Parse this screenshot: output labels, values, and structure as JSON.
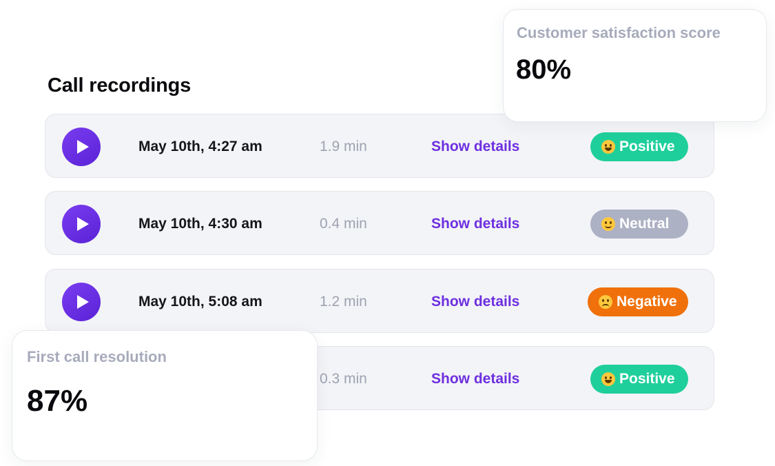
{
  "section": {
    "title": "Call recordings"
  },
  "recordings": [
    {
      "time": "May 10th, 4:27 am",
      "duration": "1.9 min",
      "details_label": "Show details",
      "sentiment": "Positive",
      "sentiment_kind": "positive",
      "sentiment_icon": "grinning-face-icon",
      "play_icon": "play-icon"
    },
    {
      "time": "May 10th, 4:30 am",
      "duration": "0.4 min",
      "details_label": "Show details",
      "sentiment": "Neutral",
      "sentiment_kind": "neutral",
      "sentiment_icon": "slightly-smiling-face-icon",
      "play_icon": "play-icon"
    },
    {
      "time": "May 10th, 5:08 am",
      "duration": "1.2 min",
      "details_label": "Show details",
      "sentiment": "Negative",
      "sentiment_kind": "negative",
      "sentiment_icon": "frowning-face-icon",
      "play_icon": "play-icon"
    },
    {
      "time": "",
      "duration": "0.3 min",
      "details_label": "Show details",
      "sentiment": "Positive",
      "sentiment_kind": "positive",
      "sentiment_icon": "grinning-face-icon",
      "play_icon": "play-icon"
    }
  ],
  "cards": {
    "csat": {
      "label": "Customer satisfaction score",
      "value": "80%"
    },
    "fcr": {
      "label": "First call resolution",
      "value": "87%"
    }
  },
  "colors": {
    "accent": "#6d2fe0",
    "play_button": "#6a2de6",
    "positive": "#1fcf9b",
    "neutral": "#acb1c4",
    "negative": "#f0710c",
    "row_background": "#f3f4f7",
    "muted_text": "#9ea3b2"
  }
}
